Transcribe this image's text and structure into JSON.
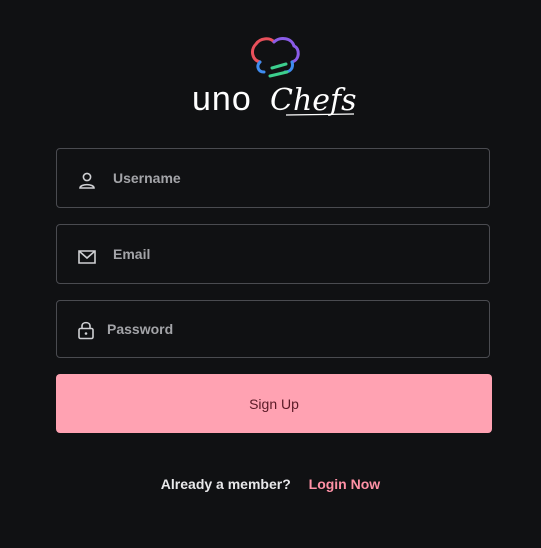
{
  "brand": {
    "name_part1": "uno",
    "name_part2": "Chefs"
  },
  "form": {
    "username": {
      "placeholder": "Username",
      "value": ""
    },
    "email": {
      "placeholder": "Email",
      "value": ""
    },
    "password": {
      "placeholder": "Password",
      "value": ""
    },
    "submit_label": "Sign Up"
  },
  "footer": {
    "question": "Already a member?",
    "login_label": "Login Now"
  },
  "icons": {
    "username": "person-icon",
    "email": "envelope-icon",
    "password": "lock-icon"
  },
  "colors": {
    "background": "#101113",
    "field_border": "#4a4b50",
    "button": "#ffa2b2",
    "link": "#ff91a6",
    "logo_red": "#e8505b",
    "logo_blue": "#3f8cf0",
    "logo_purple": "#8a5ce8",
    "logo_green": "#3ccf8e"
  }
}
